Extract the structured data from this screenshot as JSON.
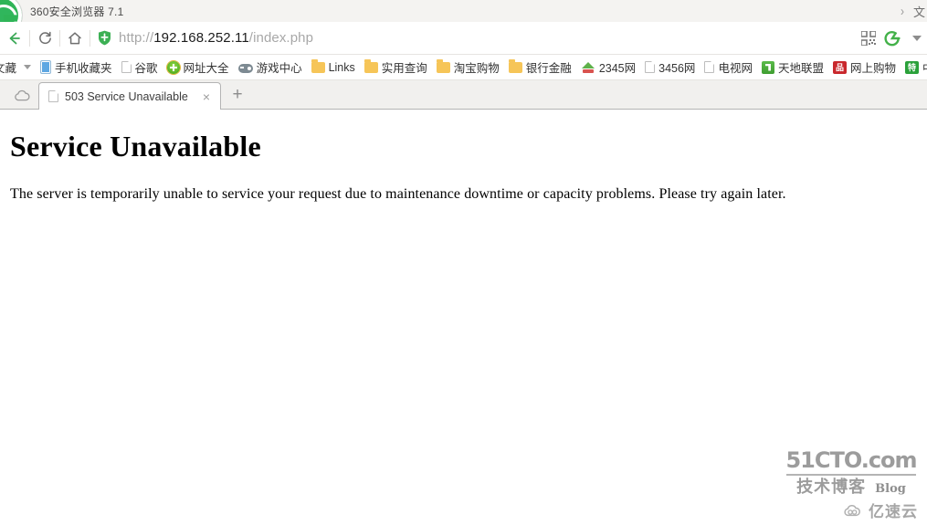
{
  "window": {
    "app_title": "360安全浏览器 7.1",
    "titlebar_right": {
      "chevron": "›",
      "cjk_fragment": "文"
    }
  },
  "toolbar": {
    "back_label": "←",
    "reload_label": "⟳",
    "home_label": "⌂",
    "shield_icon": "green-shield-icon",
    "url": {
      "scheme": "http://",
      "host": "192.168.252.11",
      "path": "/index.php"
    },
    "right_icons": [
      {
        "name": "qr-code-icon",
        "label": "QR"
      },
      {
        "name": "browser-e-icon",
        "label": "e"
      },
      {
        "name": "chevron-down-icon",
        "label": "▾"
      }
    ]
  },
  "bookmarks": {
    "favorites_menu_label": "文藏",
    "items": [
      {
        "label": "手机收藏夹",
        "icon": "phone-icon"
      },
      {
        "label": "谷歌",
        "icon": "page-icon"
      },
      {
        "label": "网址大全",
        "icon": "circle-plus-icon"
      },
      {
        "label": "游戏中心",
        "icon": "gamepad-icon"
      },
      {
        "label": "Links",
        "icon": "folder-icon"
      },
      {
        "label": "实用查询",
        "icon": "folder-icon"
      },
      {
        "label": "淘宝购物",
        "icon": "folder-icon"
      },
      {
        "label": "银行金融",
        "icon": "folder-icon"
      },
      {
        "label": "2345网",
        "icon": "roof-icon"
      },
      {
        "label": "3456网",
        "icon": "page-icon"
      },
      {
        "label": "电视网",
        "icon": "page-icon"
      },
      {
        "label": "天地联盟",
        "icon": "green-square-icon"
      },
      {
        "label": "网上购物",
        "icon": "red-badge-icon",
        "badge_text": "品"
      },
      {
        "label": "中国",
        "icon": "green-badge-icon",
        "badge_text": "特"
      }
    ]
  },
  "tabs": {
    "cloud_button_label": "cloud-icon",
    "active": {
      "title": "503 Service Unavailable",
      "favicon": "page-icon",
      "close_label": "×"
    },
    "new_tab_label": "+"
  },
  "page": {
    "heading": "Service Unavailable",
    "body": "The server is temporarily unable to service your request due to maintenance downtime or capacity problems. Please try again later."
  },
  "watermark": {
    "line1": "51CTO.com",
    "line2_cn": "技术博客",
    "line2_en": "Blog",
    "line3": "亿速云",
    "cloud_icon": "cloud-icon"
  },
  "colors": {
    "accent_green": "#2fb457",
    "titlebar_bg": "#f4f3f1",
    "tabstrip_bg": "#f1f0ee",
    "page_bg": "#ffffff",
    "url_host": "#1c1c1c",
    "url_dim": "#a8a8a8"
  }
}
